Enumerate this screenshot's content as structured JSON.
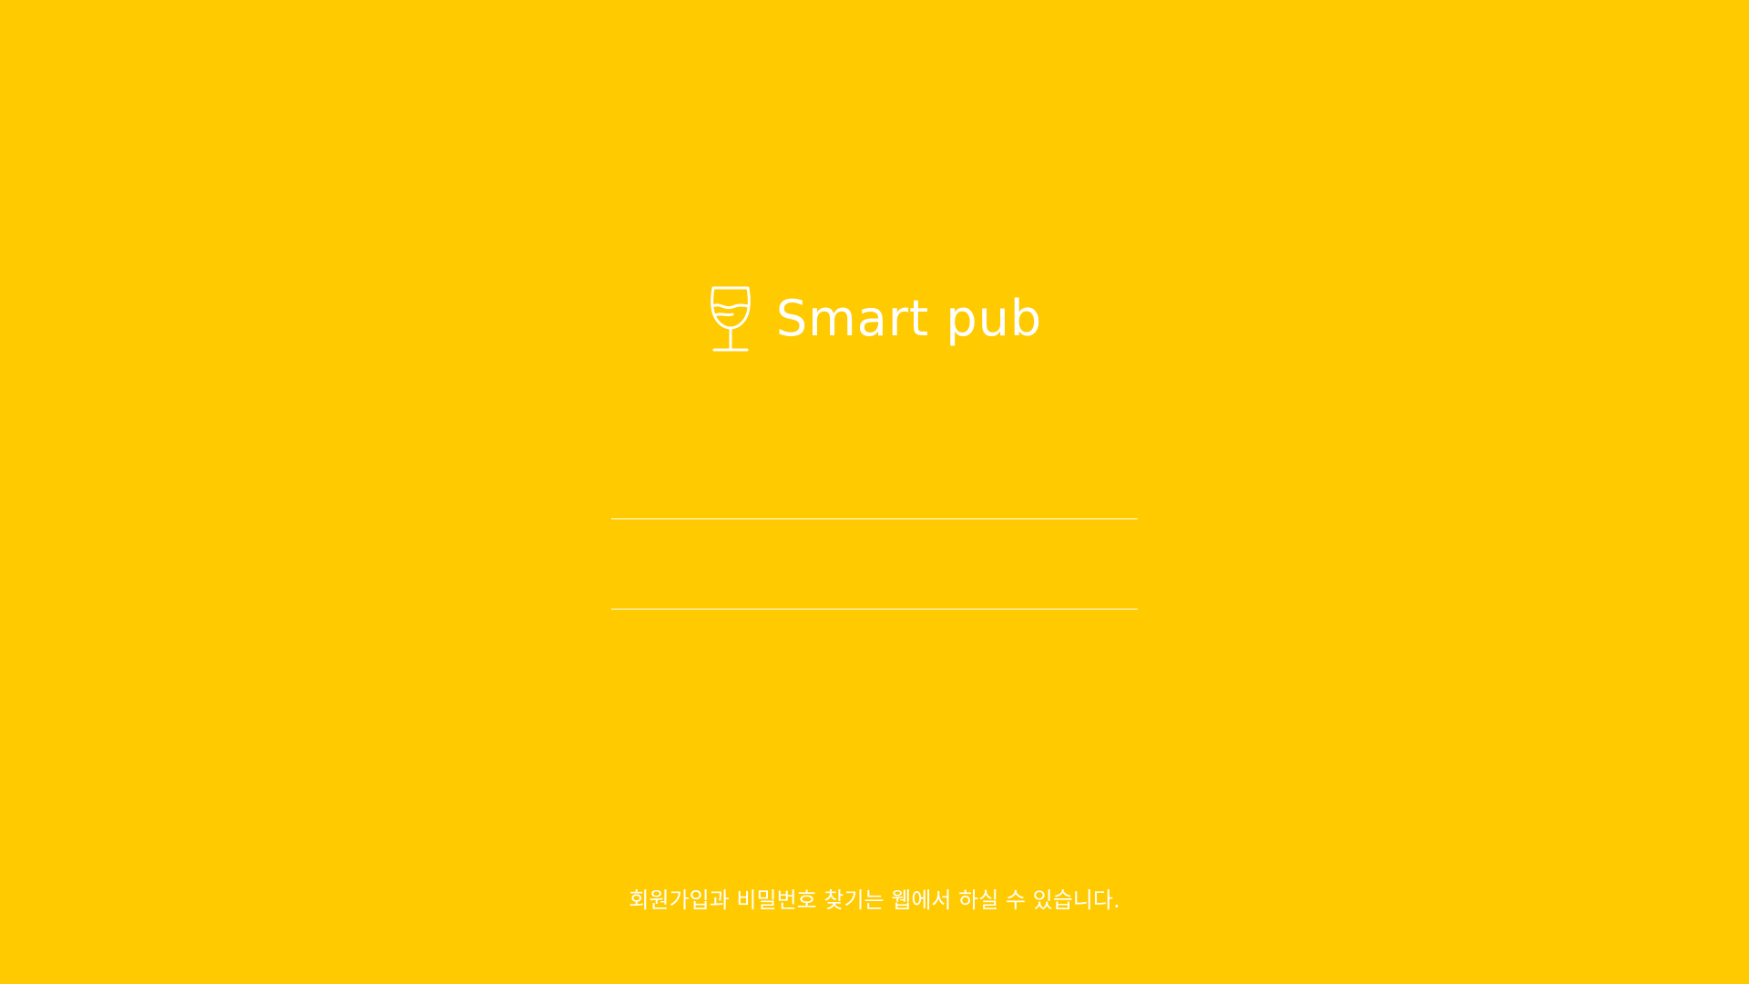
{
  "app": {
    "title": "Smart pub",
    "logo_icon": "wine-glass-icon"
  },
  "login": {
    "id_value": "",
    "password_value": ""
  },
  "footer": {
    "notice": "회원가입과 비밀번호 찾기는 웹에서 하실 수 있습니다."
  },
  "colors": {
    "background": "#FFCA00",
    "foreground": "#FFFFFF"
  }
}
